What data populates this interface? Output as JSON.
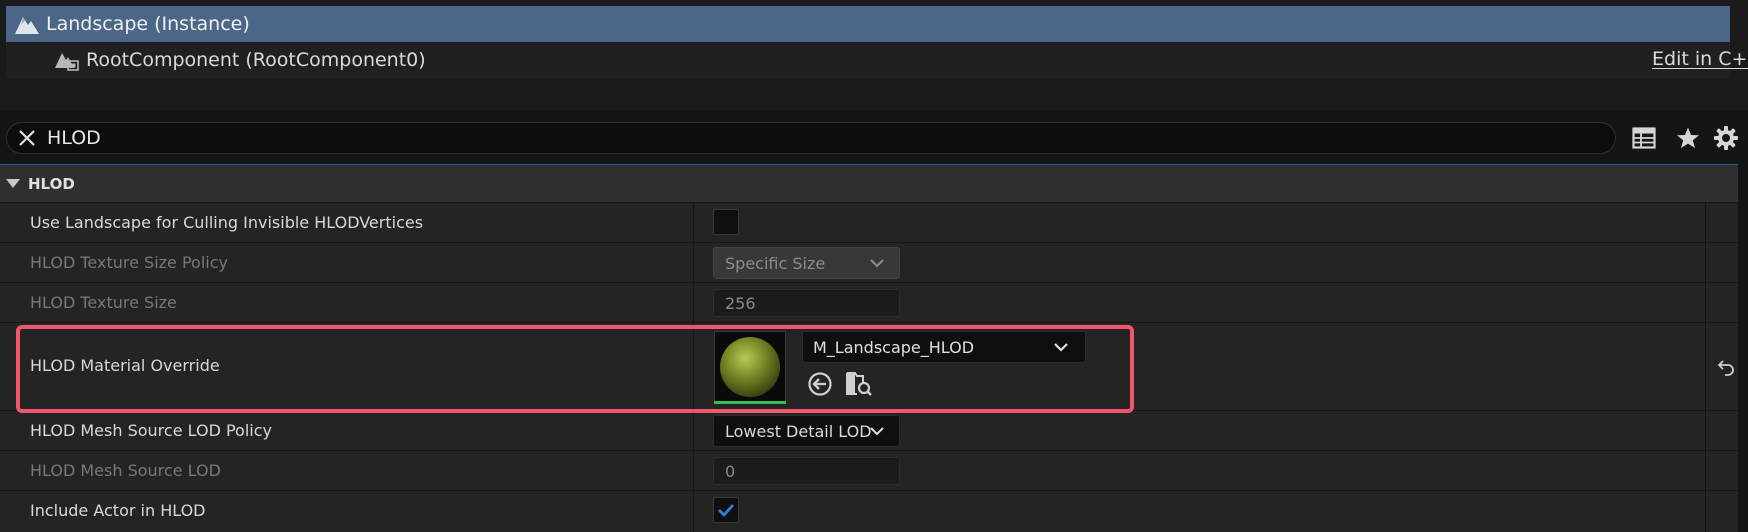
{
  "tree": {
    "actor_label": "Landscape (Instance)",
    "root_label": "RootComponent (RootComponent0)",
    "edit_cpp": "Edit in C++"
  },
  "search": {
    "value": "HLOD"
  },
  "category": {
    "title": "HLOD"
  },
  "properties": {
    "use_landscape_culling": {
      "label": "Use Landscape for Culling Invisible HLODVertices",
      "checked": false
    },
    "texture_size_policy": {
      "label": "HLOD Texture Size Policy",
      "value": "Specific Size"
    },
    "texture_size": {
      "label": "HLOD Texture Size",
      "value": "256"
    },
    "material_override": {
      "label": "HLOD Material Override",
      "value": "M_Landscape_HLOD"
    },
    "mesh_source_lod_policy": {
      "label": "HLOD Mesh Source LOD Policy",
      "value": "Lowest Detail LOD"
    },
    "mesh_source_lod": {
      "label": "HLOD Mesh Source LOD",
      "value": "0"
    },
    "include_actor": {
      "label": "Include Actor in HLOD",
      "checked": true
    }
  },
  "icons": {
    "actor": "landscape-icon",
    "root": "scene-component-icon",
    "clear": "close-icon",
    "grid": "table-view-icon",
    "star": "star-icon",
    "gear": "gear-icon",
    "use_selected": "use-selected-arrow-icon",
    "browse": "browse-asset-icon",
    "reset": "reset-to-default-icon",
    "chevron": "chevron-down-icon",
    "check": "checkmark-icon"
  },
  "colors": {
    "selection": "#4b6686",
    "highlight": "#f0566d",
    "check": "#2f7de1",
    "material_bar": "#33c14a"
  }
}
